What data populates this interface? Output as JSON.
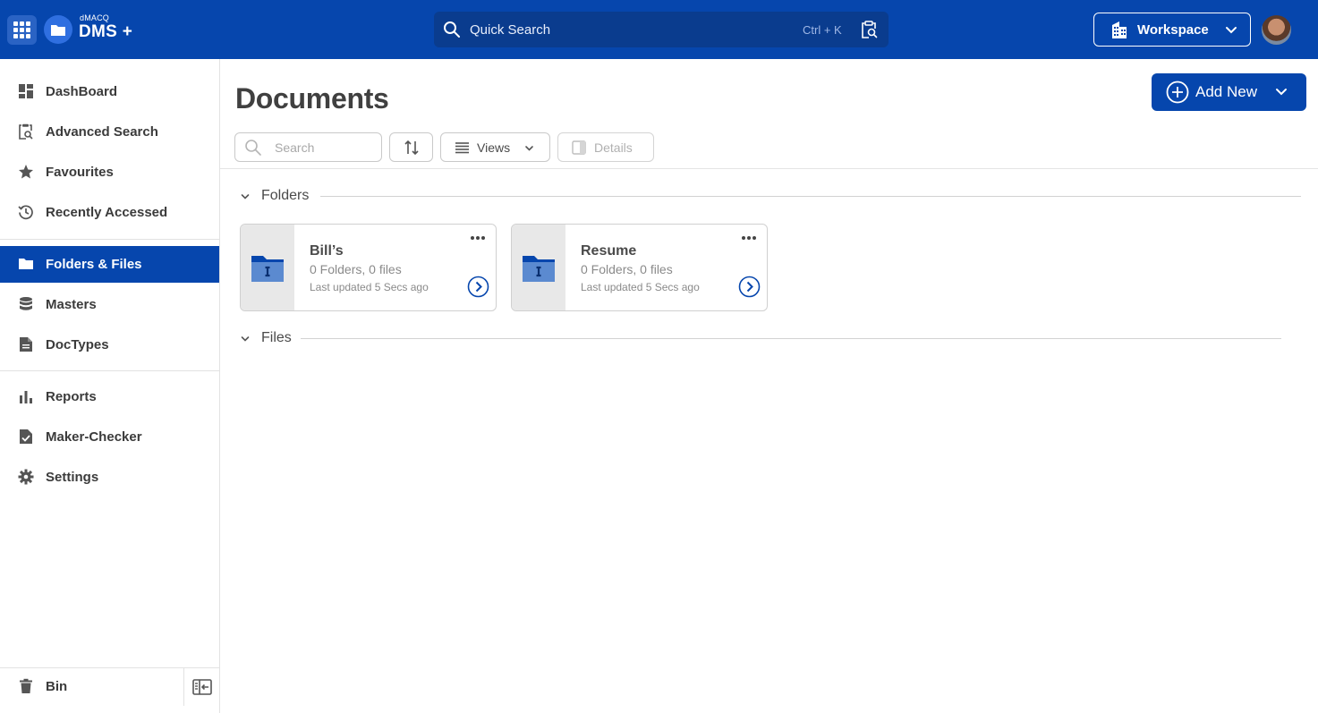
{
  "app": {
    "logo_small": "dMACQ",
    "logo_big": "DMS +"
  },
  "topbar": {
    "quick_search_label": "Quick Search",
    "quick_search_shortcut": "Ctrl + K",
    "workspace_label": "Workspace"
  },
  "sidebar": {
    "items": [
      {
        "label": "DashBoard",
        "icon": "dashboard-icon"
      },
      {
        "label": "Advanced Search",
        "icon": "advanced-search-icon"
      },
      {
        "label": "Favourites",
        "icon": "star-icon"
      },
      {
        "label": "Recently Accessed",
        "icon": "history-icon"
      },
      {
        "label": "Folders & Files",
        "icon": "folder-icon",
        "active": true
      },
      {
        "label": "Masters",
        "icon": "database-icon"
      },
      {
        "label": "DocTypes",
        "icon": "doctype-icon"
      },
      {
        "label": "Reports",
        "icon": "bar-chart-icon"
      },
      {
        "label": "Maker-Checker",
        "icon": "document-check-icon"
      },
      {
        "label": "Settings",
        "icon": "gear-icon"
      }
    ],
    "bin_label": "Bin"
  },
  "main": {
    "title": "Documents",
    "add_new_label": "Add New",
    "search_placeholder": "Search",
    "views_label": "Views",
    "details_label": "Details",
    "folders_section_label": "Folders",
    "files_section_label": "Files",
    "folders": [
      {
        "name": "Bill’s",
        "count": "0 Folders, 0 files",
        "updated": "Last updated 5 Secs ago"
      },
      {
        "name": "Resume",
        "count": "0 Folders, 0 files",
        "updated": "Last updated 5 Secs ago"
      }
    ]
  },
  "colors": {
    "brand": "#0646ad",
    "folder_icon": "#0646ad"
  }
}
